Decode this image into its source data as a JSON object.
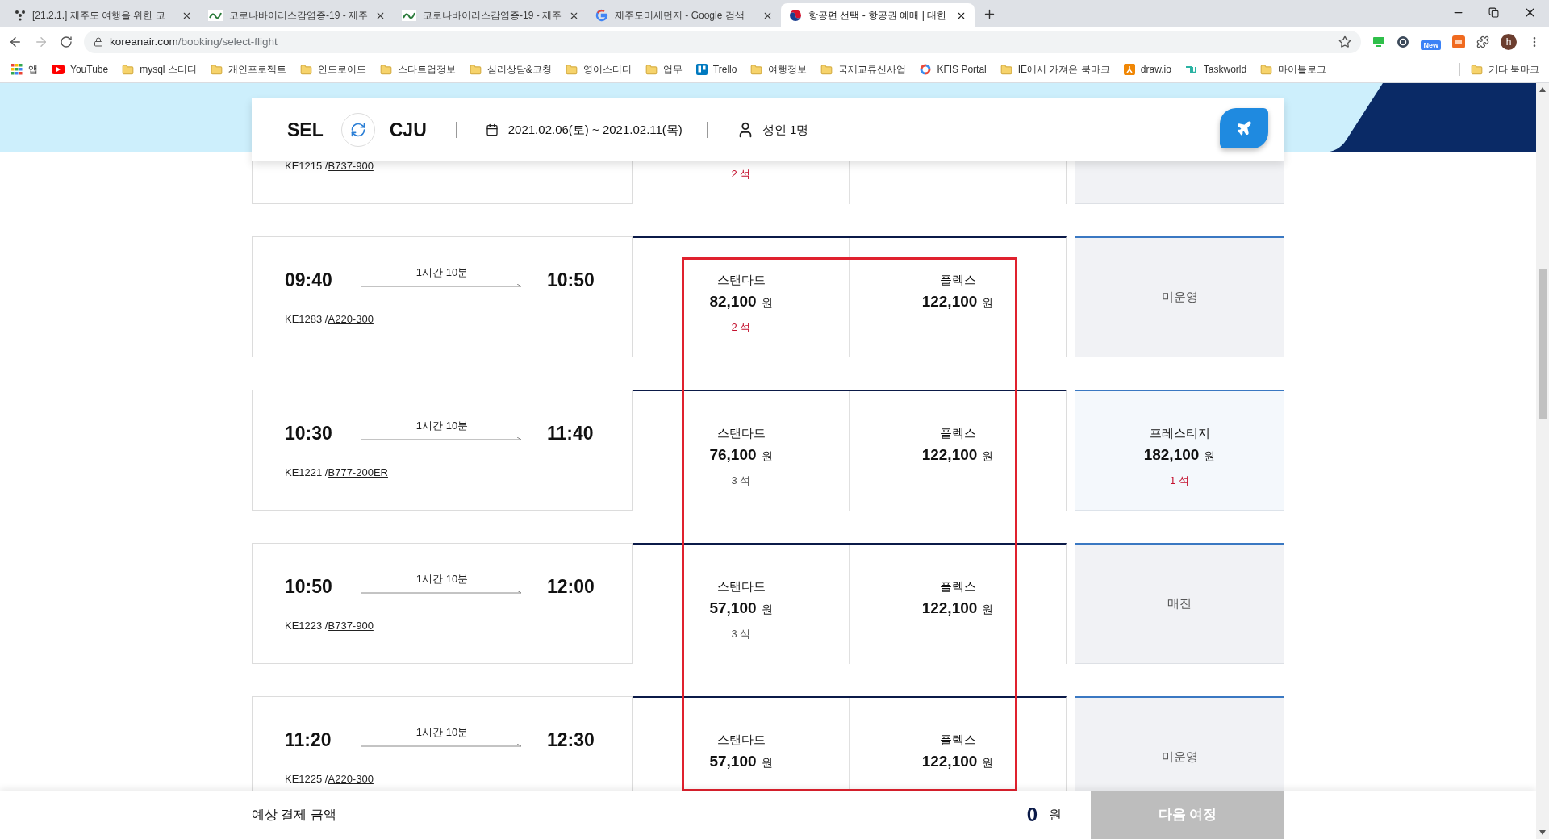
{
  "browser": {
    "tabs": [
      {
        "title": "[21.2.1.] 제주도 여행을 위한 코",
        "kind": "dots",
        "selected": false
      },
      {
        "title": "코로나바이러스감염증-19 - 제주",
        "kind": "jeju",
        "selected": false
      },
      {
        "title": "코로나바이러스감염증-19 - 제주",
        "kind": "jeju",
        "selected": false
      },
      {
        "title": "제주도미세먼지 - Google 검색",
        "kind": "google",
        "selected": false
      },
      {
        "title": "항공편 선택 - 항공권 예매 | 대한",
        "kind": "taeguk",
        "selected": true
      }
    ],
    "url_host": "koreanair.com",
    "url_path": "/booking/select-flight",
    "extension_badge": "New",
    "profile_initial": "h",
    "bookmarks": [
      {
        "label": "앱",
        "kind": "apps"
      },
      {
        "label": "YouTube",
        "kind": "youtube"
      },
      {
        "label": "mysql 스터디",
        "kind": "folder"
      },
      {
        "label": "개인프로젝트",
        "kind": "folder"
      },
      {
        "label": "안드로이드",
        "kind": "folder"
      },
      {
        "label": "스타트업정보",
        "kind": "folder"
      },
      {
        "label": "심리상담&코칭",
        "kind": "folder"
      },
      {
        "label": "영어스터디",
        "kind": "folder"
      },
      {
        "label": "업무",
        "kind": "folder"
      },
      {
        "label": "Trello",
        "kind": "trello"
      },
      {
        "label": "여행정보",
        "kind": "folder"
      },
      {
        "label": "국제교류신사업",
        "kind": "folder"
      },
      {
        "label": "KFIS Portal",
        "kind": "kfis"
      },
      {
        "label": "IE에서 가져온 북마크",
        "kind": "folder"
      },
      {
        "label": "draw.io",
        "kind": "drawio"
      },
      {
        "label": "Taskworld",
        "kind": "taskworld"
      },
      {
        "label": "마이블로그",
        "kind": "folder"
      }
    ],
    "other_bookmarks": "기타 북마크"
  },
  "search_summary": {
    "origin": "SEL",
    "destination": "CJU",
    "dates": "2021.02.06(토) ~ 2021.02.11(목)",
    "passengers": "성인 1명"
  },
  "flights": [
    {
      "flight": "KE1215 /",
      "aircraft": "B737-900",
      "fares": [
        {
          "seats": "2 석",
          "low_seats": true
        }
      ],
      "prestige": {
        "kind": "unavailable"
      }
    },
    {
      "depart": "09:40",
      "duration": "1시간 10분",
      "arrive": "10:50",
      "flight": "KE1283 /",
      "aircraft": "A220-300",
      "fares": [
        {
          "name": "스탠다드",
          "price": "82,100",
          "currency": "원",
          "seats": "2 석",
          "low_seats": true
        },
        {
          "name": "플렉스",
          "price": "122,100",
          "currency": "원"
        }
      ],
      "prestige": {
        "kind": "unavailable",
        "label": "미운영"
      }
    },
    {
      "depart": "10:30",
      "duration": "1시간 10분",
      "arrive": "11:40",
      "flight": "KE1221 /",
      "aircraft": "B777-200ER",
      "fares": [
        {
          "name": "스탠다드",
          "price": "76,100",
          "currency": "원",
          "seats": "3 석",
          "low_seats": false
        },
        {
          "name": "플렉스",
          "price": "122,100",
          "currency": "원"
        }
      ],
      "prestige": {
        "kind": "fare",
        "name": "프레스티지",
        "price": "182,100",
        "currency": "원",
        "seats": "1 석",
        "low_seats": true
      }
    },
    {
      "depart": "10:50",
      "duration": "1시간 10분",
      "arrive": "12:00",
      "flight": "KE1223 /",
      "aircraft": "B737-900",
      "fares": [
        {
          "name": "스탠다드",
          "price": "57,100",
          "currency": "원",
          "seats": "3 석",
          "low_seats": false
        },
        {
          "name": "플렉스",
          "price": "122,100",
          "currency": "원"
        }
      ],
      "prestige": {
        "kind": "unavailable",
        "label": "매진"
      }
    },
    {
      "depart": "11:20",
      "duration": "1시간 10분",
      "arrive": "12:30",
      "flight": "KE1225 /",
      "aircraft": "A220-300",
      "fares": [
        {
          "name": "스탠다드",
          "price": "57,100",
          "currency": "원"
        },
        {
          "name": "플렉스",
          "price": "122,100",
          "currency": "원"
        }
      ],
      "prestige": {
        "kind": "unavailable",
        "label": "미운영"
      }
    }
  ],
  "footer": {
    "label": "예상 결제 금액",
    "amount": "0",
    "currency": "원",
    "next_button": "다음 여정",
    "next_disabled": true
  }
}
